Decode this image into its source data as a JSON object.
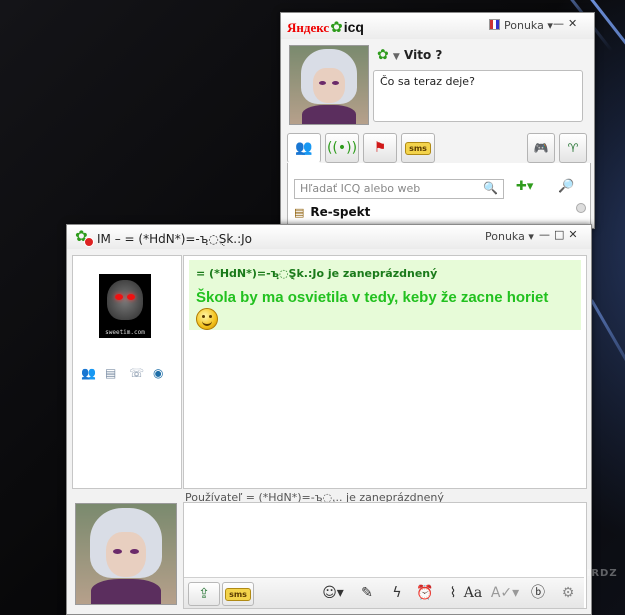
{
  "icq_window": {
    "brand_yandex": "Яндекс",
    "brand_icq": "icq",
    "menu_label": "Ponuka",
    "nick": "Vito ?",
    "status_message": "Čo sa teraz deje?",
    "tabs": [
      "contacts-tab",
      "live-tab",
      "flag-tab",
      "sms-tab"
    ],
    "sms_label": "sms",
    "search_placeholder": "Hľadať ICQ alebo web",
    "contact_group": "Re-spekt"
  },
  "im_window": {
    "title": "IM – = (*HdN*)=-ъฺ◌ֻSk.:Jo",
    "menu_label": "Ponuka",
    "busy_notice": "= (*HdN*)=-ъฺ◌ֻŞk.:Jo je zaneprázdnený",
    "message": "Škola by ma osvietila v tedy, keby že zacne horiet",
    "typing_notice": "Používateľ = (*HdN*)=-ъฺ◌ֻ... je zaneprázdnený",
    "skull_caption": "sweetim.com",
    "sms_label": "sms",
    "toolbar_font_label": "Aa"
  },
  "watermark": "BIRDZ"
}
